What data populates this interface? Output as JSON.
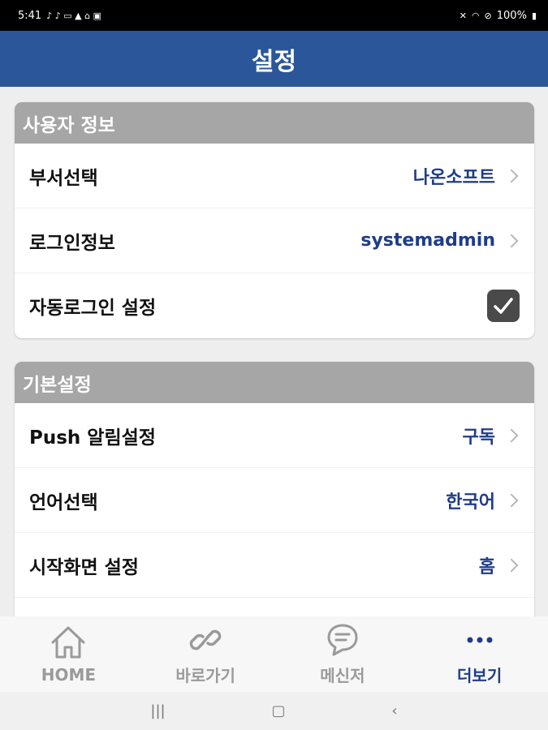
{
  "status_bar": {
    "time": "5:41",
    "battery": "100%"
  },
  "app_bar": {
    "title": "설정"
  },
  "sections": [
    {
      "header": "사용자 정보",
      "rows": [
        {
          "label": "부서선택",
          "value": "나온소프트"
        },
        {
          "label": "로그인정보",
          "value": "systemadmin"
        },
        {
          "label": "자동로그인 설정",
          "checked": true
        }
      ]
    },
    {
      "header": "기본설정",
      "rows": [
        {
          "label": "Push 알림설정",
          "value": "구독"
        },
        {
          "label": "언어선택",
          "value": "한국어"
        },
        {
          "label": "시작화면 설정",
          "value": "홈"
        }
      ]
    }
  ],
  "bottom_nav": [
    {
      "label": "HOME",
      "icon": "home-icon",
      "active": false
    },
    {
      "label": "바로가기",
      "icon": "link-icon",
      "active": false
    },
    {
      "label": "메신저",
      "icon": "chat-icon",
      "active": false
    },
    {
      "label": "더보기",
      "icon": "more-icon",
      "active": true
    }
  ],
  "colors": {
    "app_bar": "#2b579a",
    "accent": "#1f3c88",
    "section_header": "#a6a6a6"
  }
}
